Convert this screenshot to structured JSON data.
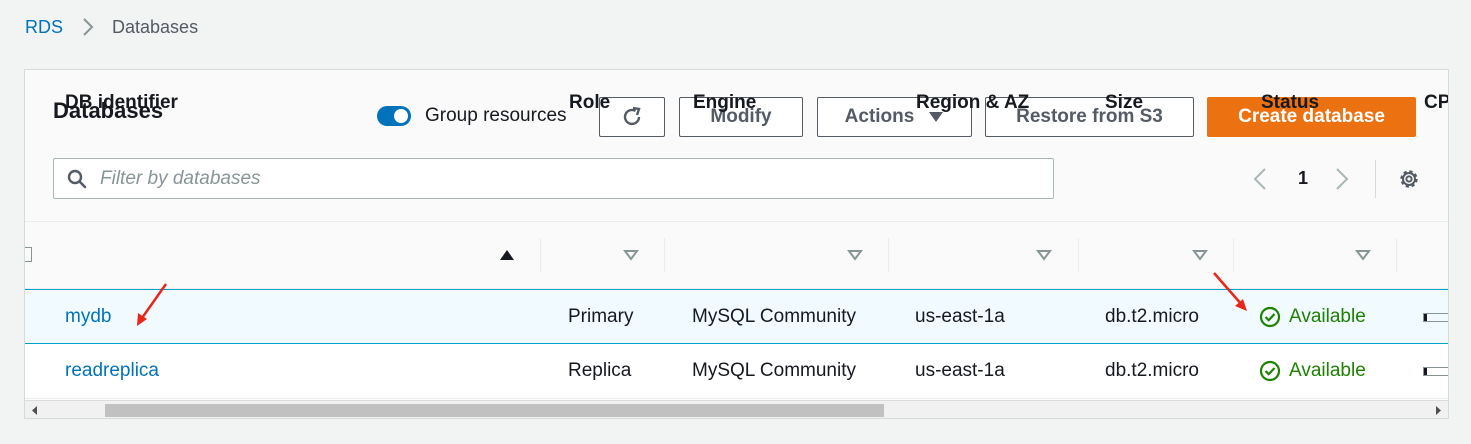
{
  "breadcrumb": {
    "root": "RDS",
    "current": "Databases"
  },
  "panel": {
    "title": "Databases",
    "group_resources": {
      "label": "Group resources",
      "enabled": true
    },
    "buttons": {
      "modify": "Modify",
      "actions": "Actions",
      "restore": "Restore from S3",
      "create": "Create database"
    },
    "search": {
      "placeholder": "Filter by databases",
      "value": ""
    },
    "pagination": {
      "current_page": "1"
    }
  },
  "table": {
    "columns": [
      "DB identifier",
      "Role",
      "Engine",
      "Region & AZ",
      "Size",
      "Status",
      "CP"
    ],
    "rows": [
      {
        "identifier": "mydb",
        "role": "Primary",
        "engine": "MySQL Community",
        "region": "us-east-1a",
        "size": "db.t2.micro",
        "status": "Available",
        "cpu_fraction": 0.05
      },
      {
        "identifier": "readreplica",
        "role": "Replica",
        "engine": "MySQL Community",
        "region": "us-east-1a",
        "size": "db.t2.micro",
        "status": "Available",
        "cpu_fraction": 0.05
      }
    ]
  },
  "colors": {
    "link": "#0073bb",
    "primary": "#ec7211",
    "success": "#1d8102",
    "annotation": "#e8271a",
    "selected_row": "#f1faff"
  },
  "icons": [
    "chevron-right-icon",
    "refresh-icon",
    "caret-down-icon",
    "search-icon",
    "chevron-left-icon",
    "gear-icon",
    "sort-up-icon",
    "sort-down-icon",
    "check-circle-icon"
  ]
}
